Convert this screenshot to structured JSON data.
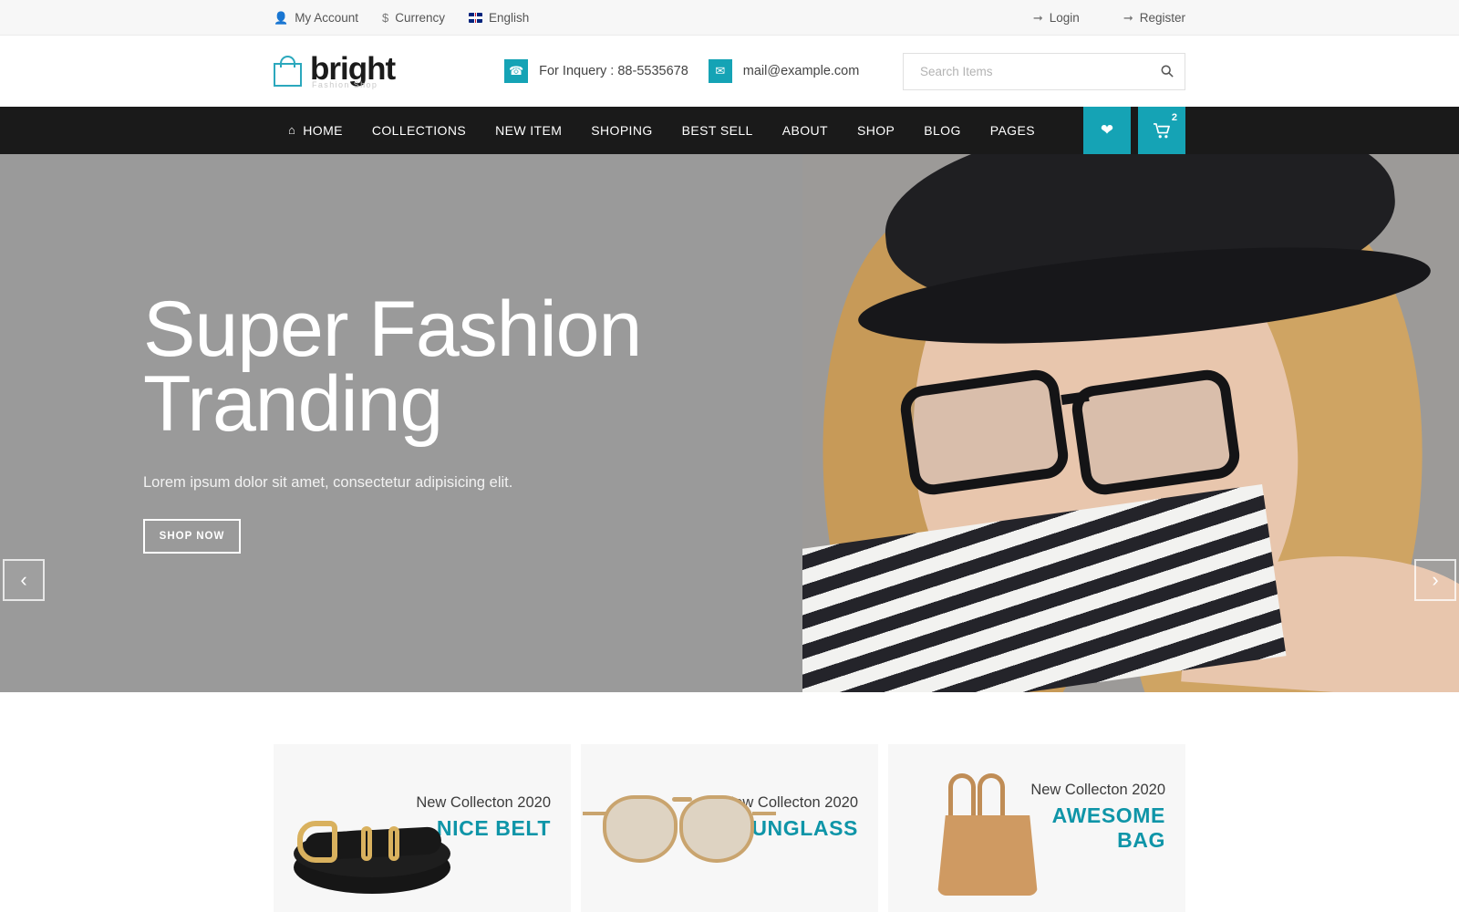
{
  "topbar": {
    "left_items": [
      {
        "label": "My Account",
        "icon": "user-icon"
      },
      {
        "label": "Currency",
        "icon": "dollar-icon"
      },
      {
        "label": "English",
        "icon": "uk-flag-icon"
      }
    ],
    "right_items": [
      {
        "label": "Login",
        "icon": "login-icon"
      },
      {
        "label": "Register",
        "icon": "register-icon"
      }
    ]
  },
  "header": {
    "logo": {
      "word": "bright",
      "tagline": "Fashion Shop",
      "icon": "shopping-bag-icon"
    },
    "phone": {
      "label": "For Inquery : 88-5535678",
      "icon": "phone-icon"
    },
    "email": {
      "label": "mail@example.com",
      "icon": "envelope-icon"
    },
    "search": {
      "placeholder": "Search Items",
      "value": "",
      "icon": "search-icon"
    }
  },
  "nav": {
    "items": [
      {
        "label": "HOME",
        "icon": "home-icon"
      },
      {
        "label": "COLLECTIONS"
      },
      {
        "label": "NEW ITEM"
      },
      {
        "label": "SHOPING"
      },
      {
        "label": "BEST SELL"
      },
      {
        "label": "ABOUT"
      },
      {
        "label": "SHOP"
      },
      {
        "label": "BLOG"
      },
      {
        "label": "PAGES"
      }
    ],
    "wishlist": {
      "icon": "heart-icon"
    },
    "cart": {
      "icon": "cart-icon",
      "badge": "2"
    }
  },
  "hero": {
    "title": "Super Fashion Tranding",
    "subtitle": "Lorem ipsum dolor sit amet, consectetur adipisicing elit.",
    "button": "SHOP NOW",
    "prev_icon": "chevron-left-icon",
    "next_icon": "chevron-right-icon"
  },
  "promos": [
    {
      "subtitle": "New Collecton 2020",
      "title": "NICE BELT",
      "image": "black-leather-belt"
    },
    {
      "subtitle": "New Collecton 2020",
      "title": "SUNGLASS",
      "image": "aviator-sunglasses"
    },
    {
      "subtitle": "New Collecton 2020",
      "title": "AWESOME BAG",
      "image": "tan-tote-bag"
    }
  ],
  "colors": {
    "accent": "#15a3b5",
    "accent_text": "#0f95a8",
    "nav_bg": "#1a1a1a",
    "topbar_bg": "#f7f7f7",
    "hero_bg": "#9a9a9a"
  }
}
